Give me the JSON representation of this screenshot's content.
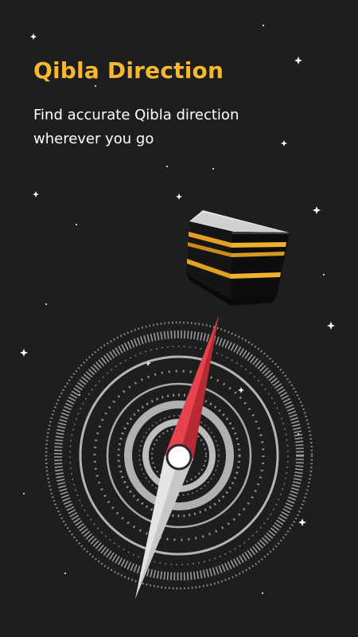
{
  "theme": {
    "background": "#1e1e1e",
    "accent": "#f5b82e",
    "text": "#ffffff",
    "needle_north": "#e8434d",
    "needle_south": "#e4e4e4",
    "kaaba_gold": "#e5a021"
  },
  "onboarding": {
    "title": "Qibla Direction",
    "description": "Find accurate Qibla direction wherever you go"
  },
  "illustration": {
    "kaaba": "kaaba-icon",
    "compass": "compass-icon",
    "stars": "star-icon"
  }
}
